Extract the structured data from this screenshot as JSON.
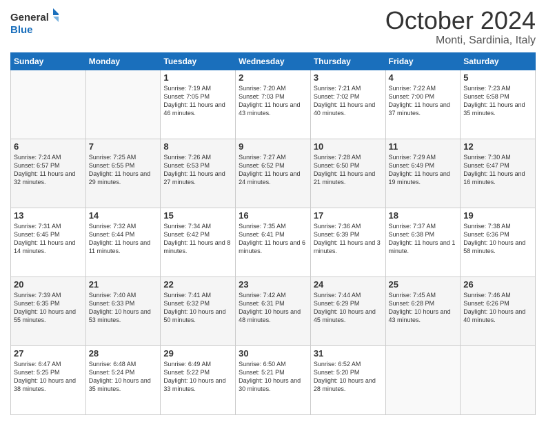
{
  "header": {
    "logo_line1": "General",
    "logo_line2": "Blue",
    "month": "October 2024",
    "location": "Monti, Sardinia, Italy"
  },
  "days_of_week": [
    "Sunday",
    "Monday",
    "Tuesday",
    "Wednesday",
    "Thursday",
    "Friday",
    "Saturday"
  ],
  "weeks": [
    [
      {
        "day": "",
        "info": ""
      },
      {
        "day": "",
        "info": ""
      },
      {
        "day": "1",
        "info": "Sunrise: 7:19 AM\nSunset: 7:05 PM\nDaylight: 11 hours and 46 minutes."
      },
      {
        "day": "2",
        "info": "Sunrise: 7:20 AM\nSunset: 7:03 PM\nDaylight: 11 hours and 43 minutes."
      },
      {
        "day": "3",
        "info": "Sunrise: 7:21 AM\nSunset: 7:02 PM\nDaylight: 11 hours and 40 minutes."
      },
      {
        "day": "4",
        "info": "Sunrise: 7:22 AM\nSunset: 7:00 PM\nDaylight: 11 hours and 37 minutes."
      },
      {
        "day": "5",
        "info": "Sunrise: 7:23 AM\nSunset: 6:58 PM\nDaylight: 11 hours and 35 minutes."
      }
    ],
    [
      {
        "day": "6",
        "info": "Sunrise: 7:24 AM\nSunset: 6:57 PM\nDaylight: 11 hours and 32 minutes."
      },
      {
        "day": "7",
        "info": "Sunrise: 7:25 AM\nSunset: 6:55 PM\nDaylight: 11 hours and 29 minutes."
      },
      {
        "day": "8",
        "info": "Sunrise: 7:26 AM\nSunset: 6:53 PM\nDaylight: 11 hours and 27 minutes."
      },
      {
        "day": "9",
        "info": "Sunrise: 7:27 AM\nSunset: 6:52 PM\nDaylight: 11 hours and 24 minutes."
      },
      {
        "day": "10",
        "info": "Sunrise: 7:28 AM\nSunset: 6:50 PM\nDaylight: 11 hours and 21 minutes."
      },
      {
        "day": "11",
        "info": "Sunrise: 7:29 AM\nSunset: 6:49 PM\nDaylight: 11 hours and 19 minutes."
      },
      {
        "day": "12",
        "info": "Sunrise: 7:30 AM\nSunset: 6:47 PM\nDaylight: 11 hours and 16 minutes."
      }
    ],
    [
      {
        "day": "13",
        "info": "Sunrise: 7:31 AM\nSunset: 6:45 PM\nDaylight: 11 hours and 14 minutes."
      },
      {
        "day": "14",
        "info": "Sunrise: 7:32 AM\nSunset: 6:44 PM\nDaylight: 11 hours and 11 minutes."
      },
      {
        "day": "15",
        "info": "Sunrise: 7:34 AM\nSunset: 6:42 PM\nDaylight: 11 hours and 8 minutes."
      },
      {
        "day": "16",
        "info": "Sunrise: 7:35 AM\nSunset: 6:41 PM\nDaylight: 11 hours and 6 minutes."
      },
      {
        "day": "17",
        "info": "Sunrise: 7:36 AM\nSunset: 6:39 PM\nDaylight: 11 hours and 3 minutes."
      },
      {
        "day": "18",
        "info": "Sunrise: 7:37 AM\nSunset: 6:38 PM\nDaylight: 11 hours and 1 minute."
      },
      {
        "day": "19",
        "info": "Sunrise: 7:38 AM\nSunset: 6:36 PM\nDaylight: 10 hours and 58 minutes."
      }
    ],
    [
      {
        "day": "20",
        "info": "Sunrise: 7:39 AM\nSunset: 6:35 PM\nDaylight: 10 hours and 55 minutes."
      },
      {
        "day": "21",
        "info": "Sunrise: 7:40 AM\nSunset: 6:33 PM\nDaylight: 10 hours and 53 minutes."
      },
      {
        "day": "22",
        "info": "Sunrise: 7:41 AM\nSunset: 6:32 PM\nDaylight: 10 hours and 50 minutes."
      },
      {
        "day": "23",
        "info": "Sunrise: 7:42 AM\nSunset: 6:31 PM\nDaylight: 10 hours and 48 minutes."
      },
      {
        "day": "24",
        "info": "Sunrise: 7:44 AM\nSunset: 6:29 PM\nDaylight: 10 hours and 45 minutes."
      },
      {
        "day": "25",
        "info": "Sunrise: 7:45 AM\nSunset: 6:28 PM\nDaylight: 10 hours and 43 minutes."
      },
      {
        "day": "26",
        "info": "Sunrise: 7:46 AM\nSunset: 6:26 PM\nDaylight: 10 hours and 40 minutes."
      }
    ],
    [
      {
        "day": "27",
        "info": "Sunrise: 6:47 AM\nSunset: 5:25 PM\nDaylight: 10 hours and 38 minutes."
      },
      {
        "day": "28",
        "info": "Sunrise: 6:48 AM\nSunset: 5:24 PM\nDaylight: 10 hours and 35 minutes."
      },
      {
        "day": "29",
        "info": "Sunrise: 6:49 AM\nSunset: 5:22 PM\nDaylight: 10 hours and 33 minutes."
      },
      {
        "day": "30",
        "info": "Sunrise: 6:50 AM\nSunset: 5:21 PM\nDaylight: 10 hours and 30 minutes."
      },
      {
        "day": "31",
        "info": "Sunrise: 6:52 AM\nSunset: 5:20 PM\nDaylight: 10 hours and 28 minutes."
      },
      {
        "day": "",
        "info": ""
      },
      {
        "day": "",
        "info": ""
      }
    ]
  ]
}
